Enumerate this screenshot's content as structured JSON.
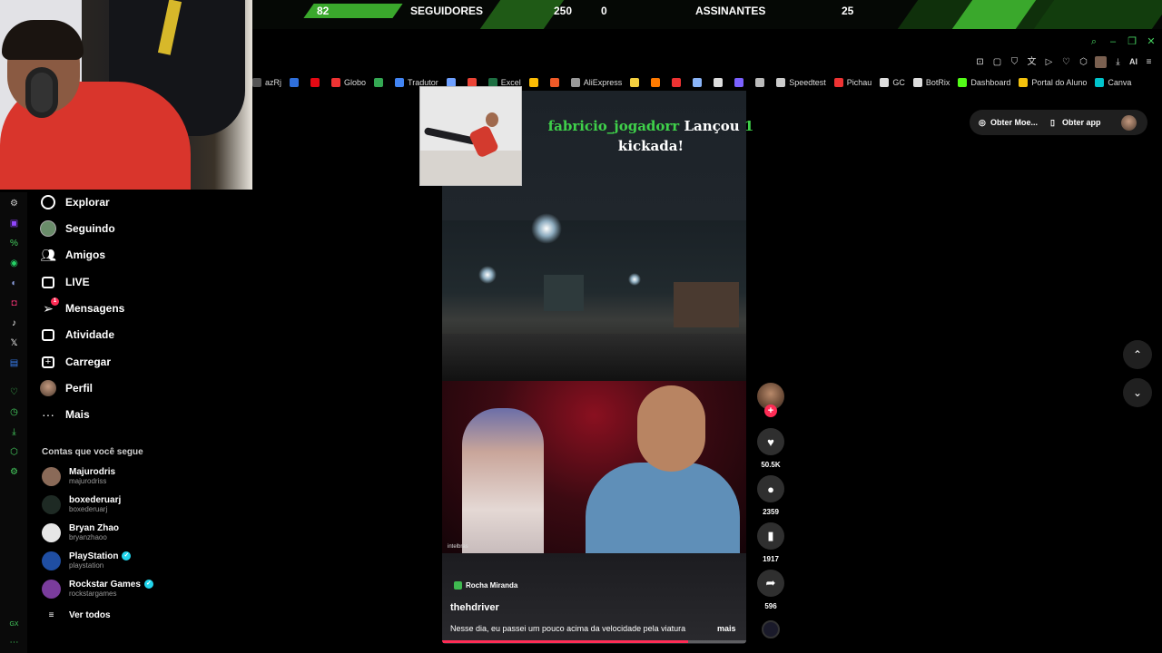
{
  "overlay": {
    "followers_count_left": "82",
    "followers_label": "SEGUIDORES",
    "followers_count_right": "250",
    "subs_count_left": "0",
    "subs_label": "ASSINANTES",
    "subs_count_right": "25",
    "accent_color": "#3aa82c"
  },
  "browser": {
    "bookmarks": [
      {
        "label": "azRj",
        "icon": "partial-bookmark-icon",
        "color": "#555555"
      },
      {
        "label": "",
        "icon": "blue-circle-icon",
        "color": "#2f6fdb"
      },
      {
        "label": "",
        "icon": "netflix-icon",
        "color": "#e50914"
      },
      {
        "label": "Globo",
        "icon": "globo-icon",
        "color": "#e33"
      },
      {
        "label": "",
        "icon": "maps-icon",
        "color": "#34a853"
      },
      {
        "label": "Tradutor",
        "icon": "translate-icon",
        "color": "#4285f4"
      },
      {
        "label": "",
        "icon": "cloud-icon",
        "color": "#6ea0ff"
      },
      {
        "label": "",
        "icon": "gmail-icon",
        "color": "#ea4335"
      },
      {
        "label": "Excel",
        "icon": "excel-icon",
        "color": "#1d6f42"
      },
      {
        "label": "",
        "icon": "drive-icon",
        "color": "#fbbc04"
      },
      {
        "label": "",
        "icon": "orange-square-icon",
        "color": "#f05a28"
      },
      {
        "label": "AliExpress",
        "icon": "document-icon",
        "color": "#999999"
      },
      {
        "label": "",
        "icon": "yellow-pill-icon",
        "color": "#f4d03f"
      },
      {
        "label": "",
        "icon": "orange-box-icon",
        "color": "#ff7a00"
      },
      {
        "label": "",
        "icon": "bag-icon",
        "color": "#e33"
      },
      {
        "label": "",
        "icon": "gemini-icon",
        "color": "#8ab4f8"
      },
      {
        "label": "",
        "icon": "chatgpt-icon",
        "color": "#dddddd"
      },
      {
        "label": "",
        "icon": "purple-icon",
        "color": "#7b61ff"
      },
      {
        "label": "",
        "icon": "grey-icon",
        "color": "#bbbbbb"
      },
      {
        "label": "Speedtest",
        "icon": "speedtest-icon",
        "color": "#cccccc"
      },
      {
        "label": "Pichau",
        "icon": "pichau-icon",
        "color": "#e33"
      },
      {
        "label": "GC",
        "icon": "gc-icon",
        "color": "#dddddd"
      },
      {
        "label": "BotRix",
        "icon": "botrix-icon",
        "color": "#dddddd"
      },
      {
        "label": "Dashboard",
        "icon": "kick-icon",
        "color": "#53fc18"
      },
      {
        "label": "Portal do Aluno",
        "icon": "portal-icon",
        "color": "#f4c20d"
      },
      {
        "label": "Canva",
        "icon": "canva-icon",
        "color": "#00c4cc"
      }
    ],
    "ext_ai_label": "AI"
  },
  "sidebar": {
    "nav": [
      {
        "label": "Explorar",
        "icon": "compass-icon"
      },
      {
        "label": "Seguindo",
        "icon": "following-avatar-icon"
      },
      {
        "label": "Amigos",
        "icon": "friends-icon"
      },
      {
        "label": "LIVE",
        "icon": "live-tv-icon"
      },
      {
        "label": "Mensagens",
        "icon": "messages-icon",
        "badge": "1"
      },
      {
        "label": "Atividade",
        "icon": "activity-icon"
      },
      {
        "label": "Carregar",
        "icon": "upload-icon"
      },
      {
        "label": "Perfil",
        "icon": "profile-avatar-icon"
      },
      {
        "label": "Mais",
        "icon": "more-dots-icon"
      }
    ],
    "following_title": "Contas que você segue",
    "accounts": [
      {
        "name": "Majurodris",
        "handle": "majurodriss",
        "verified": false,
        "color": "#8a6a58"
      },
      {
        "name": "boxederuarj",
        "handle": "boxederuarj",
        "verified": false,
        "color": "#1e2a24"
      },
      {
        "name": "Bryan Zhao",
        "handle": "bryanzhaoo",
        "verified": false,
        "color": "#e6e6e6"
      },
      {
        "name": "PlayStation",
        "handle": "playstation",
        "verified": true,
        "color": "#1f4ea3"
      },
      {
        "name": "Rockstar Games",
        "handle": "rockstargames",
        "verified": true,
        "color": "#7a3c9c"
      }
    ],
    "see_all": "Ver todos"
  },
  "alert": {
    "user": "fabricio_jogadorr",
    "text_before_count": " Lançou ",
    "count": "1",
    "text_after": "kickada!"
  },
  "video": {
    "creator_tag": "Rocha Miranda",
    "handle": "thehdriver",
    "caption": "Nesse dia, eu passei um pouco acima da velocidade pela viatura",
    "more": "mais",
    "progress": 0.81,
    "likes": "50.5K",
    "comments": "2359",
    "saves": "1917",
    "shares": "596"
  },
  "header": {
    "coins": "Obter Moe...",
    "app": "Obter app"
  }
}
